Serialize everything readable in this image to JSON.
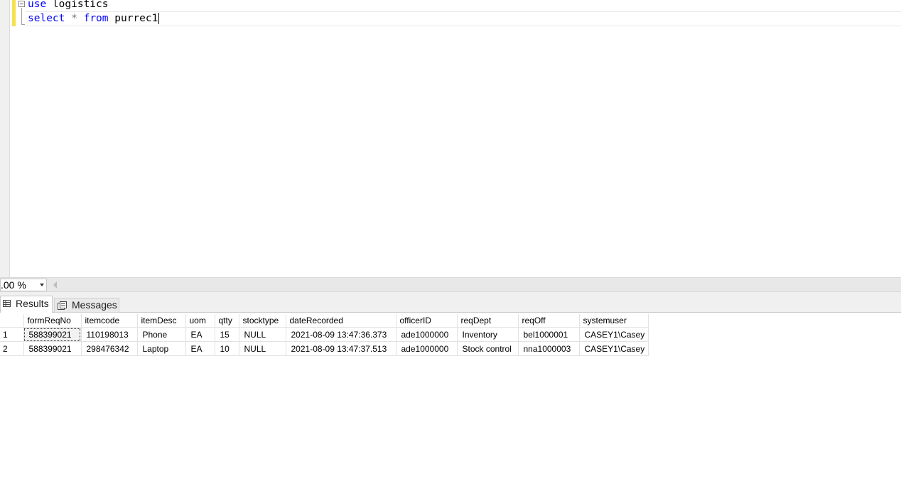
{
  "editor": {
    "line1": {
      "keyword": "use",
      "rest": " logistics"
    },
    "line2": {
      "keyword1": "select",
      "op": " * ",
      "keyword2": "from",
      "rest": " purrec1"
    }
  },
  "zoom": {
    "value": ".00 %"
  },
  "tabs": {
    "results": "Results",
    "messages": "Messages"
  },
  "grid": {
    "columns": [
      "",
      "formReqNo",
      "itemcode",
      "itemDesc",
      "uom",
      "qtty",
      "stocktype",
      "dateRecorded",
      "officerID",
      "reqDept",
      "reqOff",
      "systemuser"
    ],
    "rows": [
      [
        "1",
        "588399021",
        "110198013",
        "Phone",
        "EA",
        "15",
        "NULL",
        "2021-08-09 13:47:36.373",
        "ade1000000",
        "Inventory",
        "bel1000001",
        "CASEY1\\Casey"
      ],
      [
        "2",
        "588399021",
        "298476342",
        "Laptop",
        "EA",
        "10",
        "NULL",
        "2021-08-09 13:47:37.513",
        "ade1000000",
        "Stock control",
        "nna1000003",
        "CASEY1\\Casey"
      ]
    ]
  },
  "icons": {
    "fold": "collapse-minus-icon",
    "results": "grid-icon",
    "messages": "messages-icon",
    "dropdown": "chevron-down-icon",
    "scroll": "scroll-left-icon"
  }
}
